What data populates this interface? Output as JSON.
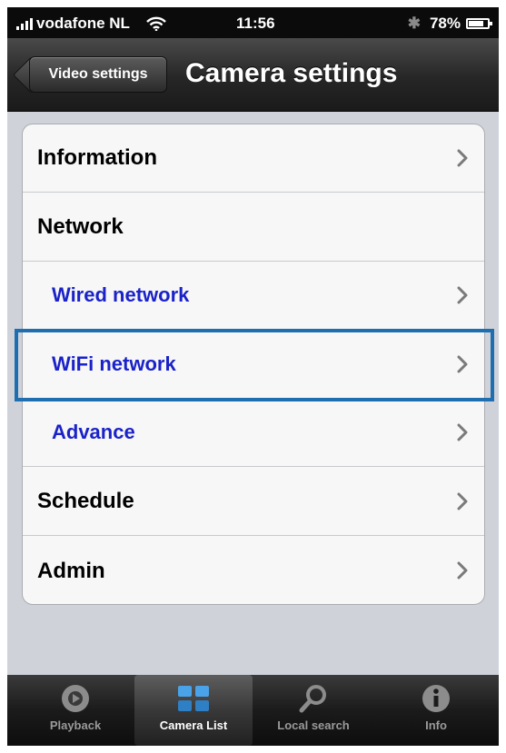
{
  "status_bar": {
    "carrier": "vodafone NL",
    "time": "11:56",
    "battery": "78%",
    "battery_level": 0.78
  },
  "nav_bar": {
    "back_label": "Video settings",
    "title": "Camera settings"
  },
  "settings_list": {
    "items": [
      {
        "label": "Information",
        "type": "item",
        "chevron": true
      },
      {
        "label": "Network",
        "type": "header",
        "chevron": false
      },
      {
        "label": "Wired network",
        "type": "subitem",
        "chevron": true
      },
      {
        "label": "WiFi network",
        "type": "subitem",
        "chevron": true,
        "highlighted": true
      },
      {
        "label": "Advance",
        "type": "subitem",
        "chevron": true
      },
      {
        "label": "Schedule",
        "type": "item",
        "chevron": true
      },
      {
        "label": "Admin",
        "type": "item",
        "chevron": true
      }
    ]
  },
  "tab_bar": {
    "tabs": [
      {
        "label": "Playback",
        "icon": "playback-icon",
        "active": false
      },
      {
        "label": "Camera List",
        "icon": "camera-list-icon",
        "active": true
      },
      {
        "label": "Local search",
        "icon": "search-icon",
        "active": false
      },
      {
        "label": "Info",
        "icon": "info-icon",
        "active": false
      }
    ]
  },
  "colors": {
    "subitem_text": "#1a22c8",
    "highlight_border": "#1f6fb0"
  }
}
